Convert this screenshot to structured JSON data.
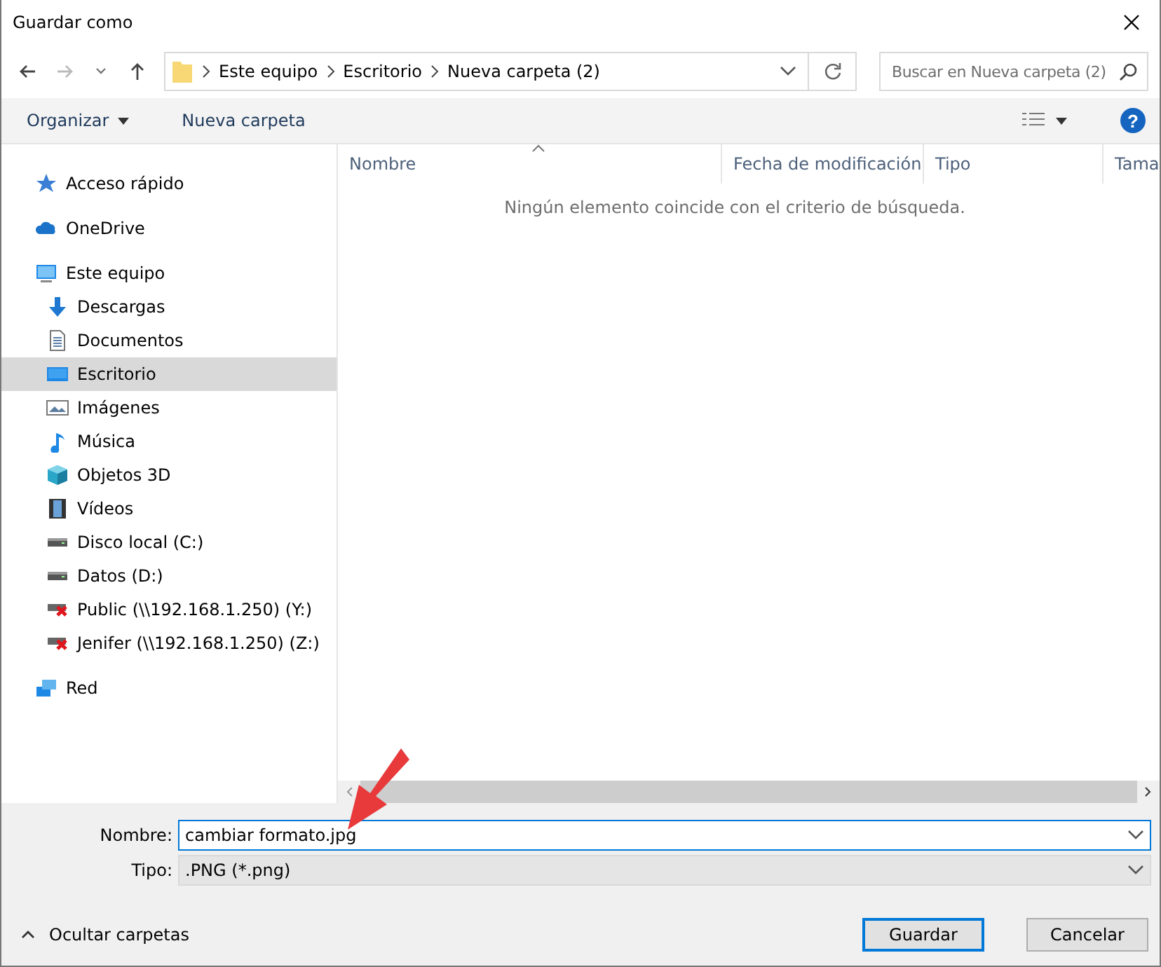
{
  "window": {
    "title": "Guardar como"
  },
  "address": {
    "crumbs": [
      "Este equipo",
      "Escritorio",
      "Nueva carpeta (2)"
    ]
  },
  "search": {
    "placeholder": "Buscar en Nueva carpeta (2)"
  },
  "toolbar": {
    "buttons": [
      "Organizar",
      "Nueva carpeta"
    ],
    "help": "?"
  },
  "sidebar": {
    "items": [
      {
        "label": "Acceso rápido",
        "selected": false
      },
      {
        "label": "OneDrive",
        "selected": false
      },
      {
        "label": "Este equipo",
        "selected": false,
        "children": [
          {
            "label": "Descargas",
            "selected": false
          },
          {
            "label": "Documentos",
            "selected": false
          },
          {
            "label": "Escritorio",
            "selected": true
          },
          {
            "label": "Imágenes",
            "selected": false
          },
          {
            "label": "Música",
            "selected": false
          },
          {
            "label": "Objetos 3D",
            "selected": false
          },
          {
            "label": "Vídeos",
            "selected": false
          },
          {
            "label": "Disco local (C:)",
            "selected": false
          },
          {
            "label": "Datos (D:)",
            "selected": false
          },
          {
            "label": "Public (\\\\192.168.1.250) (Y:)",
            "selected": false
          },
          {
            "label": "Jenifer (\\\\192.168.1.250) (Z:)",
            "selected": false
          }
        ]
      },
      {
        "label": "Red",
        "selected": false
      }
    ]
  },
  "table": {
    "columns": [
      "Nombre",
      "Fecha de modificación",
      "Tipo",
      "Tama"
    ],
    "empty_message": "Ningún elemento coincide con el criterio de búsqueda."
  },
  "form": {
    "name_label": "Nombre:",
    "name_value": "cambiar formato.jpg",
    "type_label": "Tipo:",
    "type_value": ".PNG (*.png)"
  },
  "footer": {
    "toggle": "Ocultar carpetas",
    "buttons": [
      "Guardar",
      "Cancelar"
    ]
  }
}
